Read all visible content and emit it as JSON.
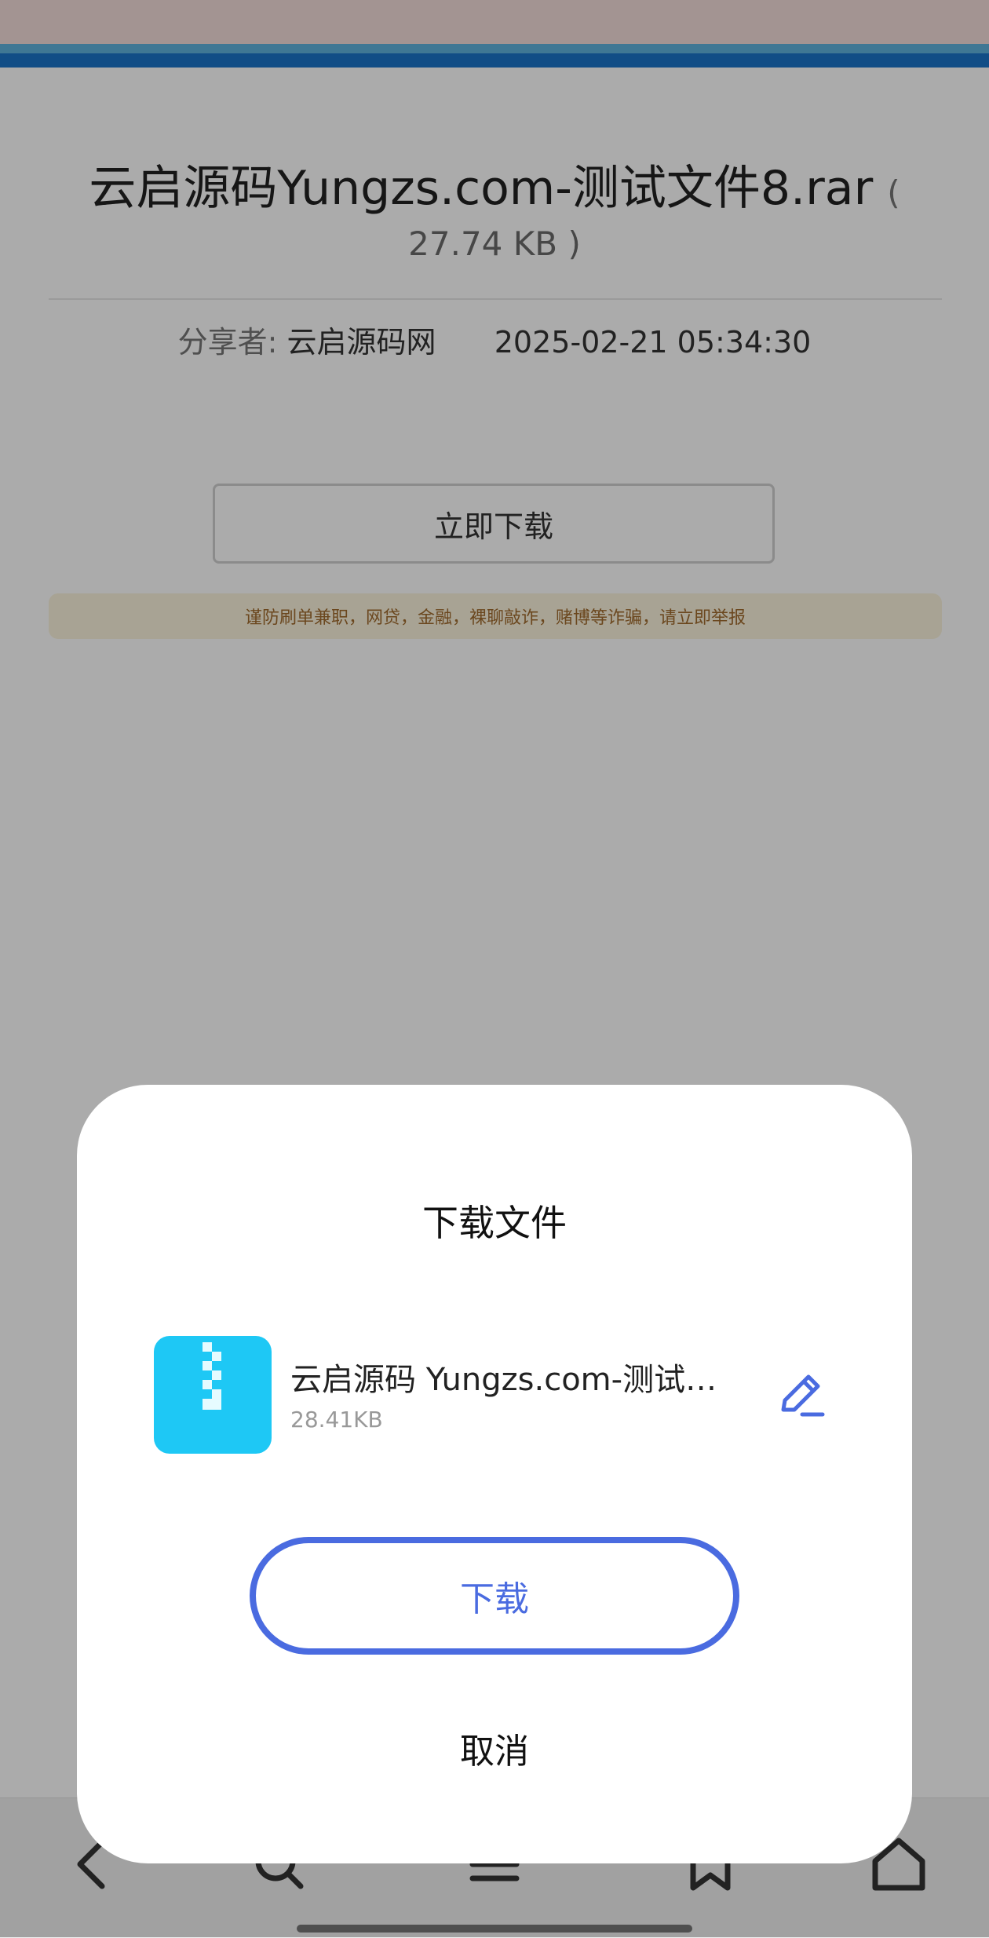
{
  "page": {
    "file_title": "云启源码Yungzs.com-测试文件8.rar",
    "open_paren": "(",
    "file_size_line": "27.74 KB )",
    "sharer_label": "分享者:",
    "sharer_name": "云启源码网",
    "shared_time": "2025-02-21 05:34:30",
    "download_now_label": "立即下载",
    "warning_text": "谨防刷单兼职，网贷，金融，裸聊敲诈，赌博等诈骗，请立即举报"
  },
  "dialog": {
    "title": "下载文件",
    "file_icon": "zip-archive-icon",
    "file_name": "云启源码 Yungzs.com-测试…",
    "file_size": "28.41KB",
    "edit_icon": "pencil-icon",
    "download_label": "下载",
    "cancel_label": "取消"
  },
  "bottom_nav": {
    "items": [
      "back-icon",
      "search-icon",
      "menu-icon",
      "bookmark-icon",
      "home-icon"
    ]
  },
  "colors": {
    "accent": "#4a6be0",
    "zip_icon_bg": "#1ec8f5",
    "top_bar_blue": "#1a74c8",
    "warning_bg": "#fbf4dd",
    "warning_text": "#a06a2e"
  }
}
